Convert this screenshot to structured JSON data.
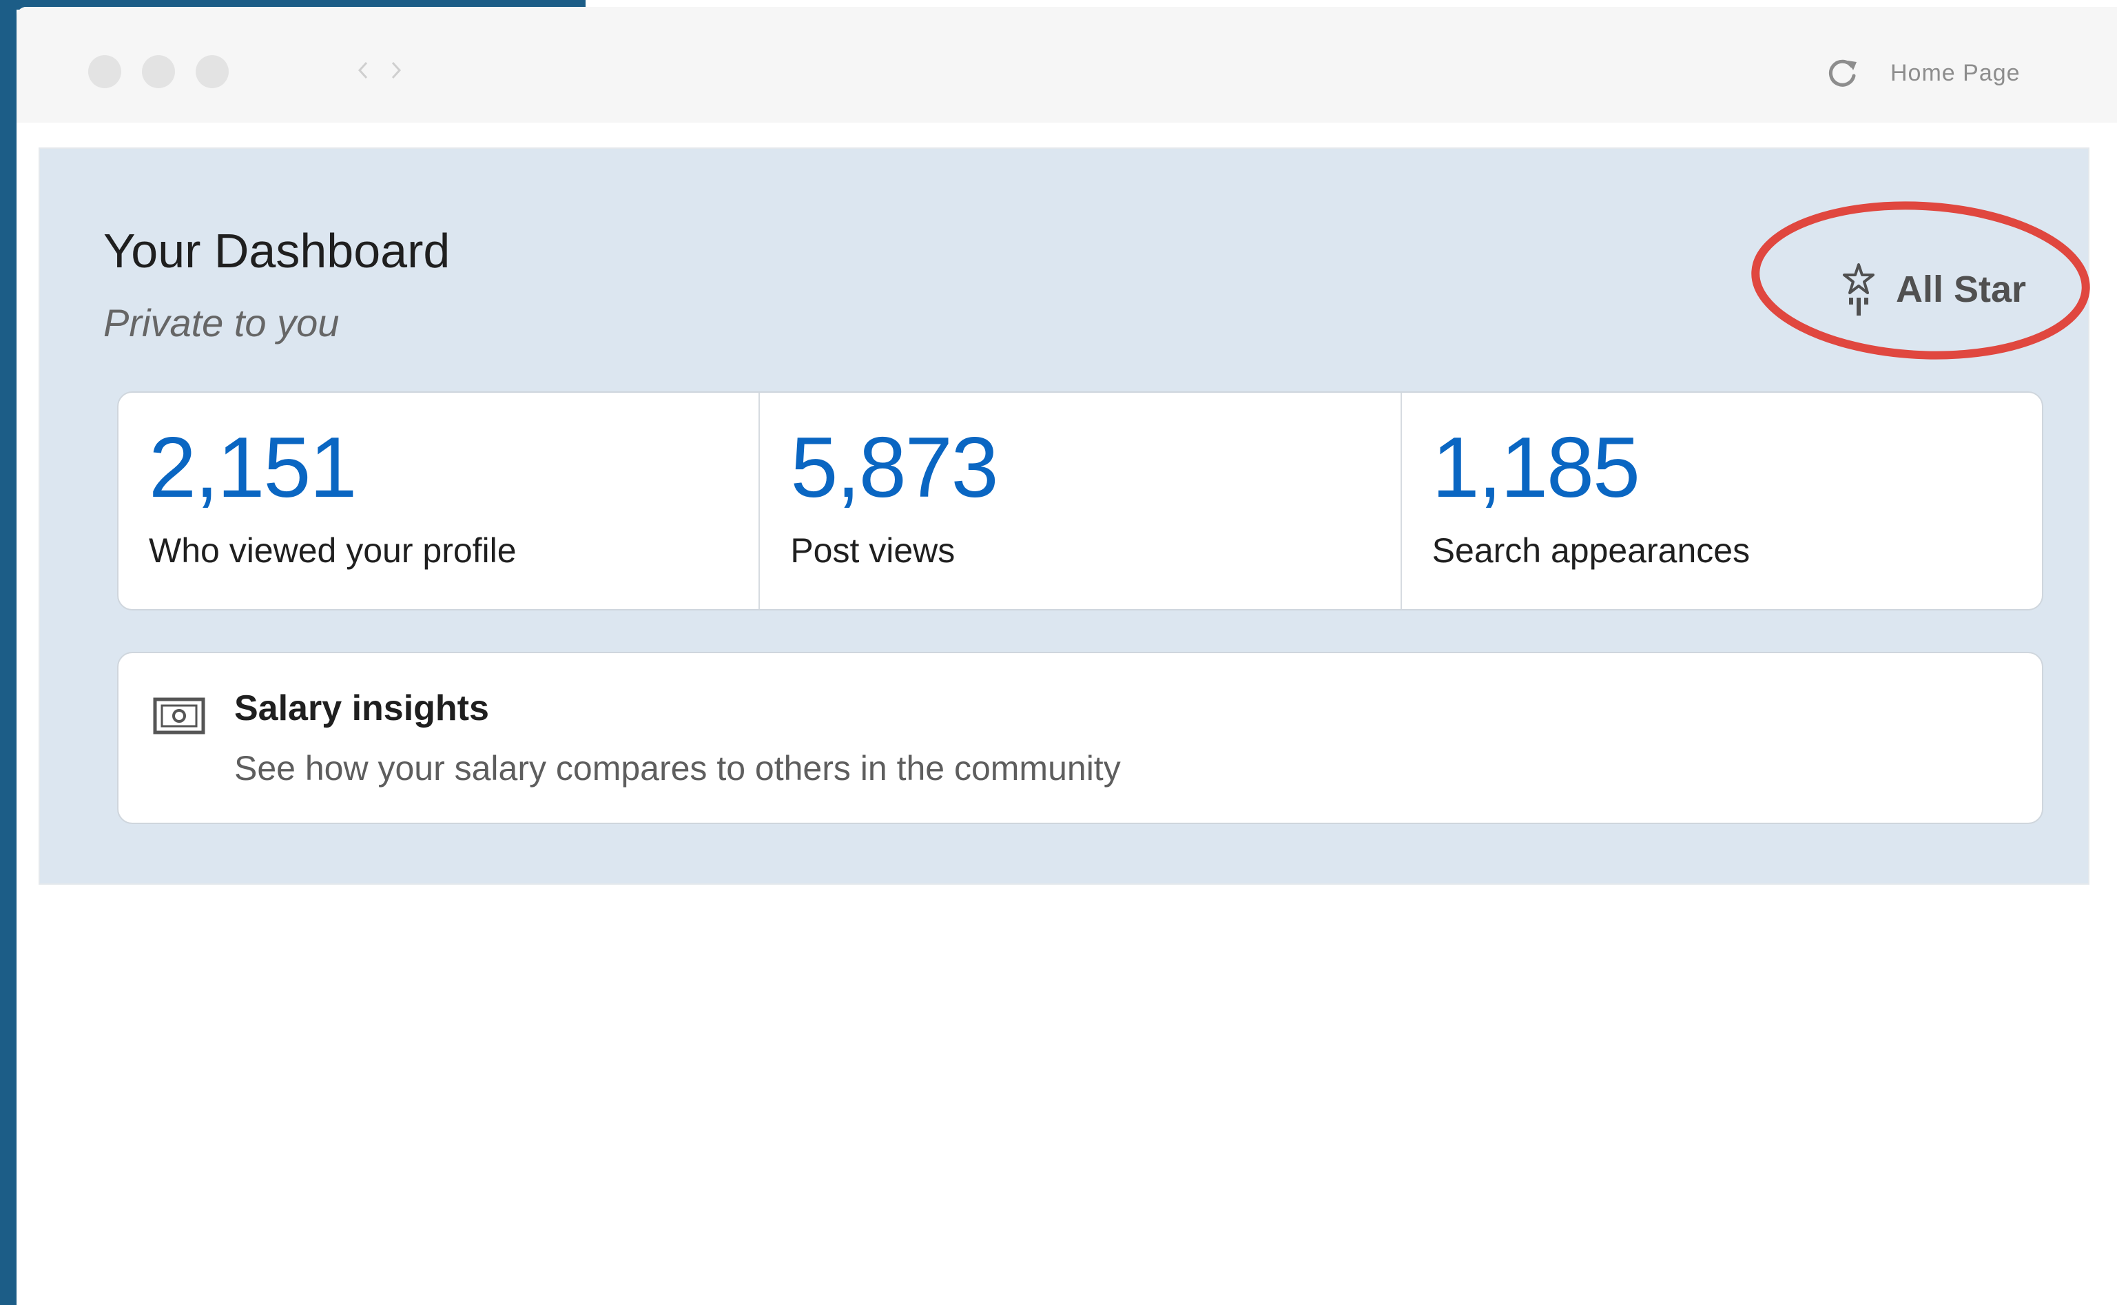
{
  "browser": {
    "address_label": "Home Page",
    "icons": {
      "reload": "reload-icon",
      "back": "chevron-left-icon",
      "forward": "chevron-right-icon"
    }
  },
  "dashboard": {
    "title": "Your Dashboard",
    "subtitle": "Private to you",
    "badge": {
      "label": "All Star",
      "icon": "all-star-icon",
      "highlight_color": "#e0473f"
    },
    "stats": [
      {
        "value": "2,151",
        "label": "Who viewed your profile"
      },
      {
        "value": "5,873",
        "label": "Post views"
      },
      {
        "value": "1,185",
        "label": "Search appearances"
      }
    ],
    "salary": {
      "icon": "money-icon",
      "title": "Salary insights",
      "description": "See how your salary compares to others in the community"
    }
  },
  "colors": {
    "accent": "#0a66c2",
    "panel_background": "#dce6f0",
    "frame": "#1c5d87"
  }
}
